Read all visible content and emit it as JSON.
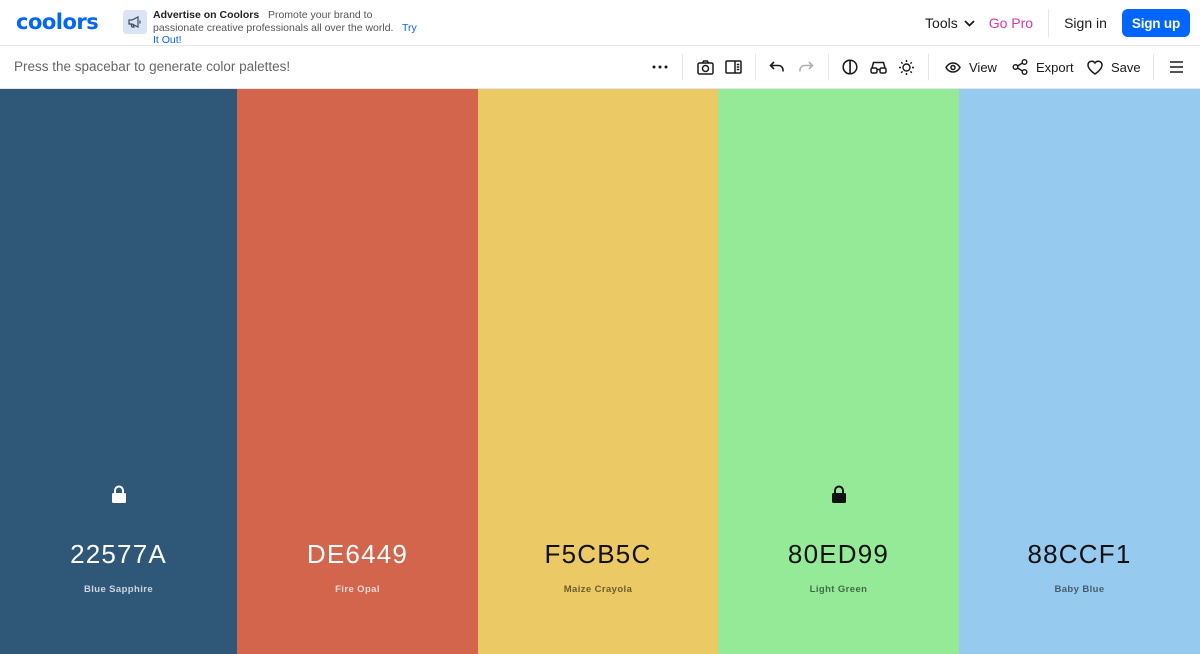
{
  "brand": {
    "logo_text": "coolors",
    "accent": "#0066ff"
  },
  "ad": {
    "title": "Advertise on Coolors",
    "body": "Promote your brand to passionate creative professionals all over the world.",
    "link": "Try It Out!"
  },
  "nav": {
    "tools": "Tools",
    "go_pro": "Go Pro",
    "go_pro_color": "#e1359d",
    "sign_in": "Sign in",
    "sign_up": "Sign up"
  },
  "toolbar": {
    "hint": "Press the spacebar to generate color palettes!",
    "view": "View",
    "export": "Export",
    "save": "Save",
    "icons": [
      "more-icon",
      "camera-icon",
      "sidebar-icon",
      "undo-icon",
      "redo-icon",
      "contrast-icon",
      "glasses-icon",
      "brightness-icon",
      "eye-icon",
      "share-icon",
      "heart-icon",
      "menu-icon"
    ]
  },
  "palette": {
    "colors": [
      {
        "hex": "22577A",
        "name": "Blue Sapphire",
        "bg": "#2f5878",
        "text_theme": "light",
        "locked": true
      },
      {
        "hex": "DE6449",
        "name": "Fire Opal",
        "bg": "#d2654c",
        "text_theme": "light",
        "locked": false
      },
      {
        "hex": "F5CB5C",
        "name": "Maize Crayola",
        "bg": "#ebc964",
        "text_theme": "dark",
        "locked": false
      },
      {
        "hex": "80ED99",
        "name": "Light Green",
        "bg": "#94ea97",
        "text_theme": "dark",
        "locked": true
      },
      {
        "hex": "88CCF1",
        "name": "Baby Blue",
        "bg": "#97caef",
        "text_theme": "dark",
        "locked": false
      }
    ]
  }
}
